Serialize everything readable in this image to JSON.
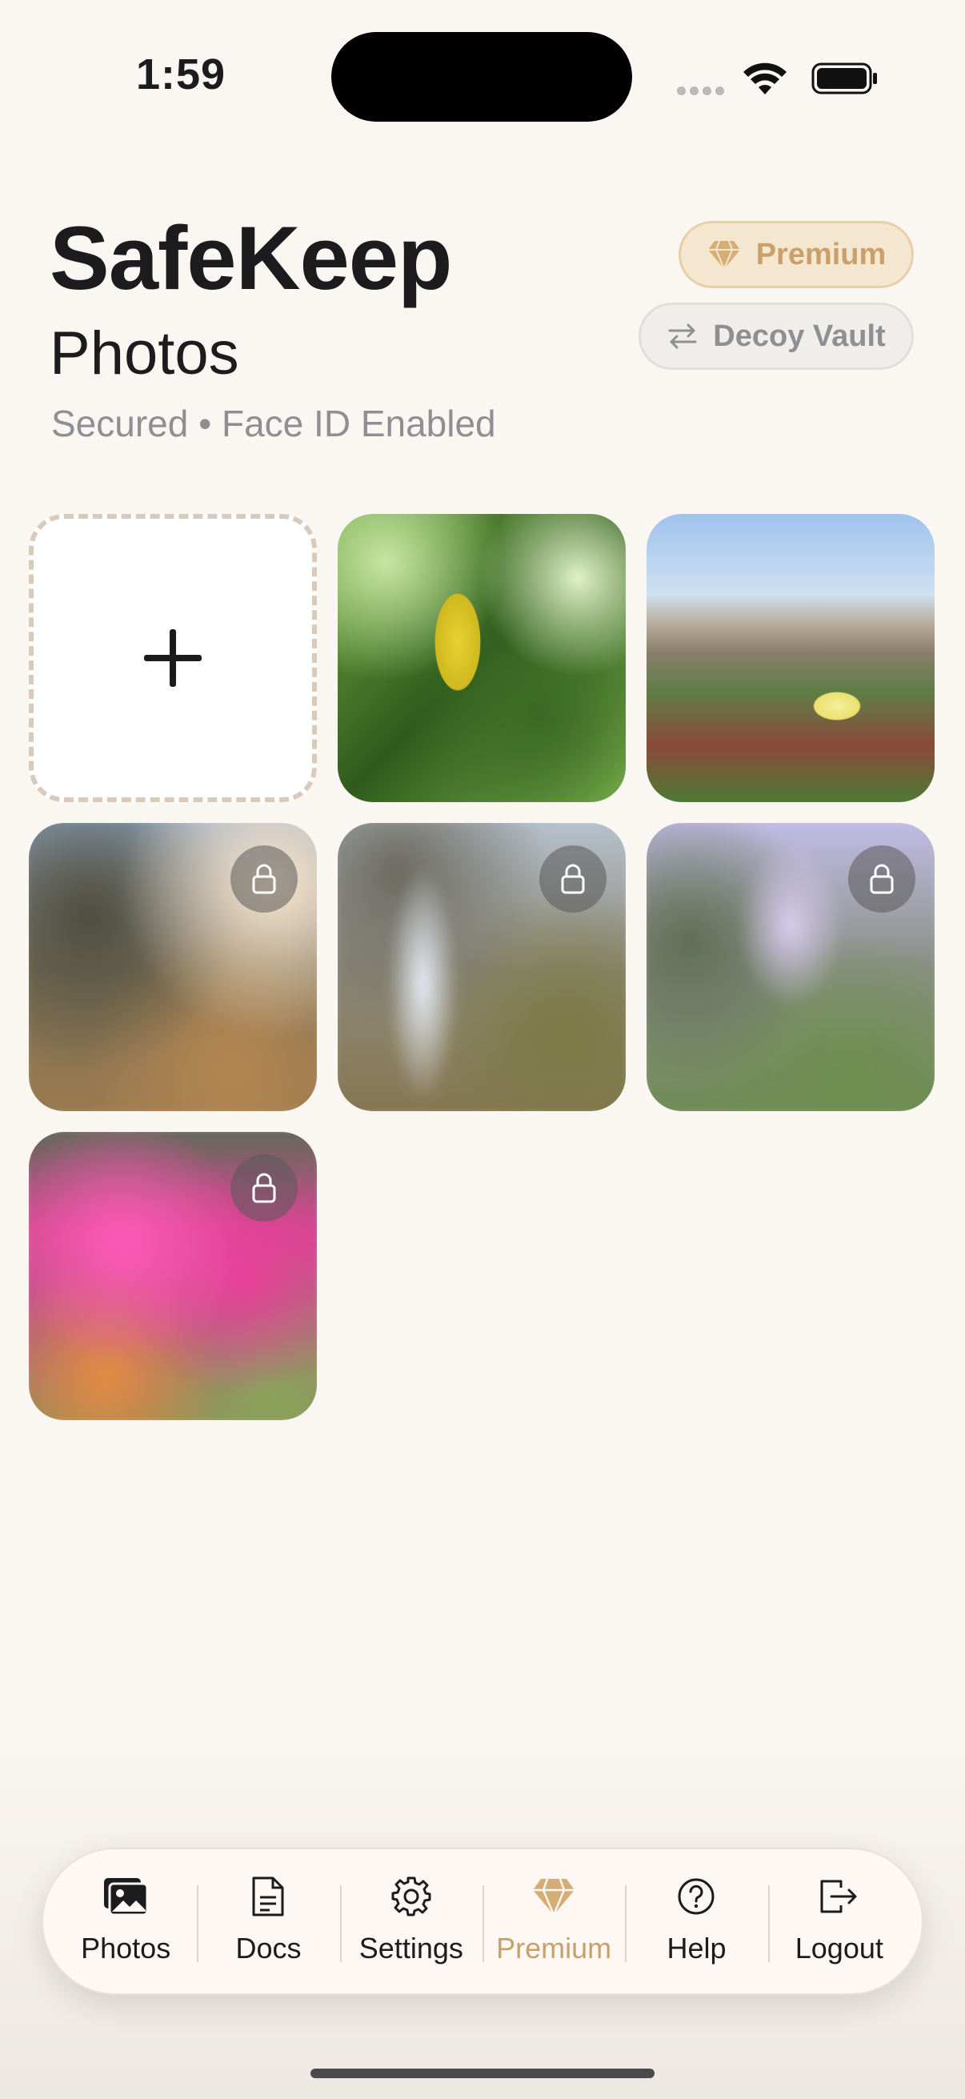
{
  "status_bar": {
    "time": "1:59"
  },
  "header": {
    "app_title": "SafeKeep",
    "section_title": "Photos",
    "security_status": "Secured • Face ID Enabled",
    "premium_label": "Premium",
    "decoy_label": "Decoy Vault"
  },
  "grid": {
    "add_tile": "add-photo",
    "photos": [
      {
        "name": "leaf-photo",
        "locked": false
      },
      {
        "name": "beach-grass-photo",
        "locked": false
      },
      {
        "name": "blurred-photo-1",
        "locked": true
      },
      {
        "name": "blurred-photo-2",
        "locked": true
      },
      {
        "name": "blurred-photo-3",
        "locked": true
      },
      {
        "name": "blurred-photo-4",
        "locked": true
      }
    ]
  },
  "tabbar": {
    "tabs": [
      {
        "label": "Photos",
        "icon": "photos-icon"
      },
      {
        "label": "Docs",
        "icon": "document-icon"
      },
      {
        "label": "Settings",
        "icon": "gear-icon"
      },
      {
        "label": "Premium",
        "icon": "diamond-icon",
        "active": true
      },
      {
        "label": "Help",
        "icon": "help-icon"
      },
      {
        "label": "Logout",
        "icon": "logout-icon"
      }
    ]
  },
  "colors": {
    "background": "#faf6f2",
    "accent_gold": "#c9a06a",
    "text_primary": "#1c1c1e",
    "text_secondary": "#8e8e93"
  }
}
